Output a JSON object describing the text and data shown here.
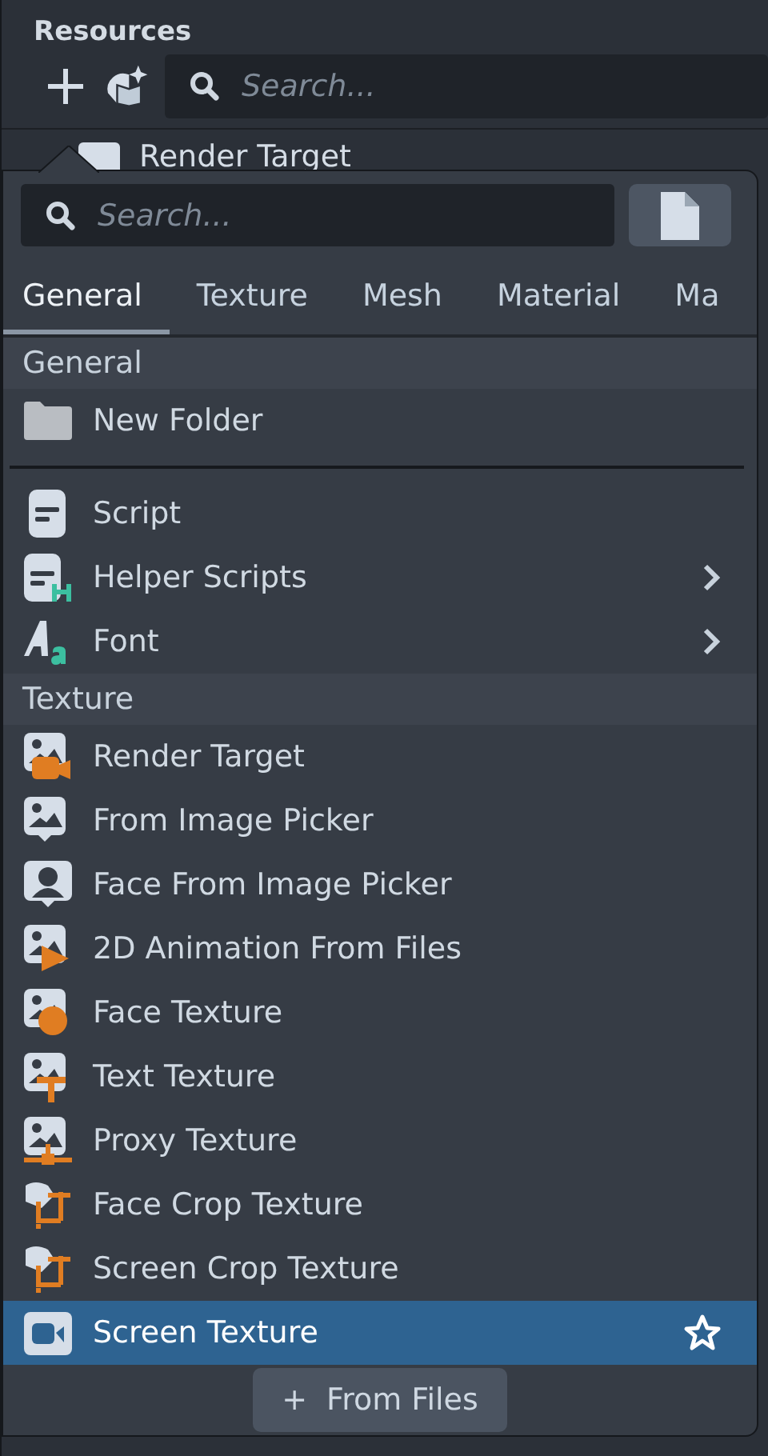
{
  "panel": {
    "title": "Resources",
    "search": {
      "placeholder": "Search..."
    },
    "background_row": {
      "label": "Render Target"
    }
  },
  "popup": {
    "search": {
      "placeholder": "Search..."
    },
    "tabs": [
      {
        "label": "General",
        "selected": true
      },
      {
        "label": "Texture",
        "selected": false
      },
      {
        "label": "Mesh",
        "selected": false
      },
      {
        "label": "Material",
        "selected": false
      },
      {
        "label": "Ma",
        "selected": false
      }
    ],
    "sections": [
      {
        "title": "General",
        "groups": [
          [
            {
              "label": "New Folder",
              "submenu": false,
              "selected": false
            }
          ],
          [
            {
              "label": "Script",
              "submenu": false,
              "selected": false
            },
            {
              "label": "Helper Scripts",
              "submenu": true,
              "selected": false
            },
            {
              "label": "Font",
              "submenu": true,
              "selected": false
            }
          ]
        ]
      },
      {
        "title": "Texture",
        "groups": [
          [
            {
              "label": "Render Target",
              "submenu": false,
              "selected": false
            },
            {
              "label": "From Image Picker",
              "submenu": false,
              "selected": false
            },
            {
              "label": "Face From Image Picker",
              "submenu": false,
              "selected": false
            },
            {
              "label": "2D Animation From Files",
              "submenu": false,
              "selected": false
            },
            {
              "label": "Face Texture",
              "submenu": false,
              "selected": false
            },
            {
              "label": "Text Texture",
              "submenu": false,
              "selected": false
            },
            {
              "label": "Proxy Texture",
              "submenu": false,
              "selected": false
            },
            {
              "label": "Face Crop Texture",
              "submenu": false,
              "selected": false
            },
            {
              "label": "Screen Crop Texture",
              "submenu": false,
              "selected": false
            },
            {
              "label": "Screen Texture",
              "submenu": false,
              "selected": true
            }
          ]
        ]
      }
    ],
    "footer_button": {
      "icon": "+",
      "label": "From Files"
    }
  }
}
